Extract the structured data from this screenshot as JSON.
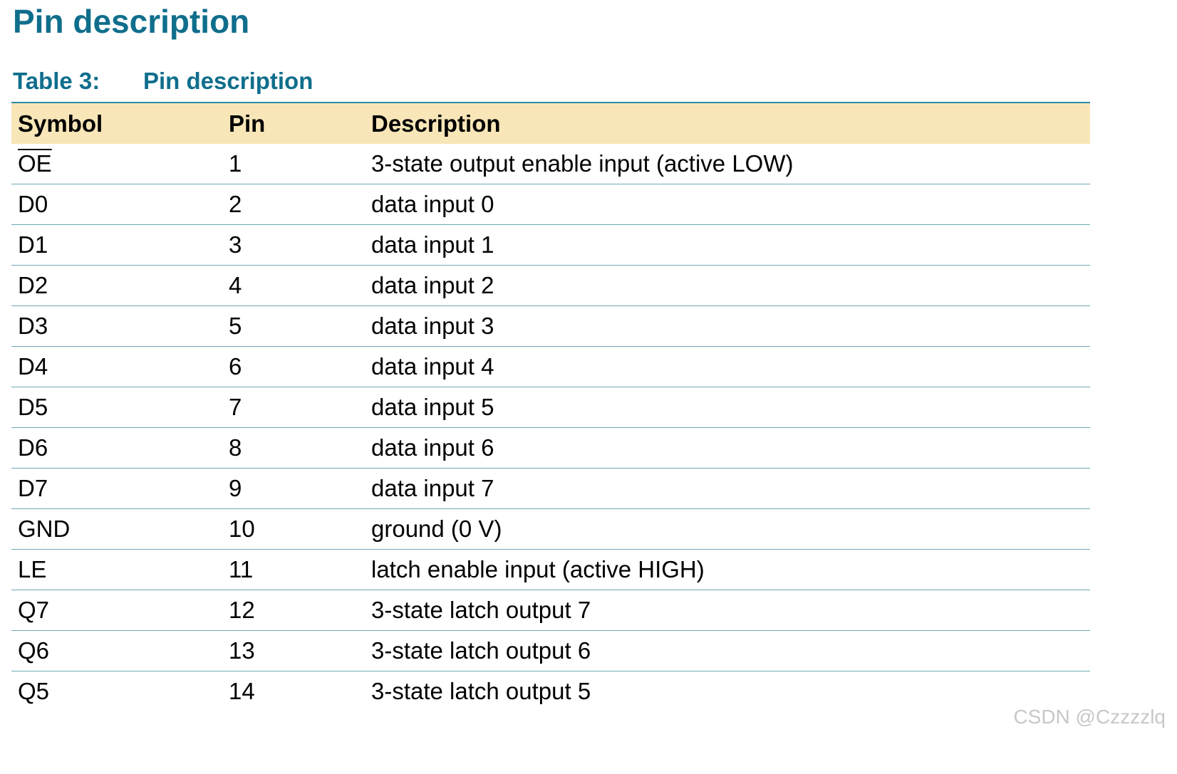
{
  "page_title": "Pin description",
  "table": {
    "caption_number": "Table 3:",
    "caption_title": "Pin description",
    "header_color": "#f8e6b8",
    "accent_color": "#0f6e8c",
    "columns": [
      "Symbol",
      "Pin",
      "Description"
    ],
    "rows": [
      {
        "symbol": "OE",
        "symbol_overline": true,
        "pin": "1",
        "description": "3-state output enable input (active LOW)"
      },
      {
        "symbol": "D0",
        "pin": "2",
        "description": "data input 0"
      },
      {
        "symbol": "D1",
        "pin": "3",
        "description": "data input 1"
      },
      {
        "symbol": "D2",
        "pin": "4",
        "description": "data input 2"
      },
      {
        "symbol": "D3",
        "pin": "5",
        "description": "data input 3"
      },
      {
        "symbol": "D4",
        "pin": "6",
        "description": "data input 4"
      },
      {
        "symbol": "D5",
        "pin": "7",
        "description": "data input 5"
      },
      {
        "symbol": "D6",
        "pin": "8",
        "description": "data input 6"
      },
      {
        "symbol": "D7",
        "pin": "9",
        "description": "data input 7"
      },
      {
        "symbol": "GND",
        "pin": "10",
        "description": "ground (0 V)"
      },
      {
        "symbol": "LE",
        "pin": "11",
        "description": "latch enable input (active HIGH)"
      },
      {
        "symbol": "Q7",
        "pin": "12",
        "description": "3-state latch output 7"
      },
      {
        "symbol": "Q6",
        "pin": "13",
        "description": "3-state latch output 6"
      },
      {
        "symbol": "Q5",
        "pin": "14",
        "description": "3-state latch output 5"
      }
    ]
  },
  "watermark": "CSDN @Czzzzlq"
}
